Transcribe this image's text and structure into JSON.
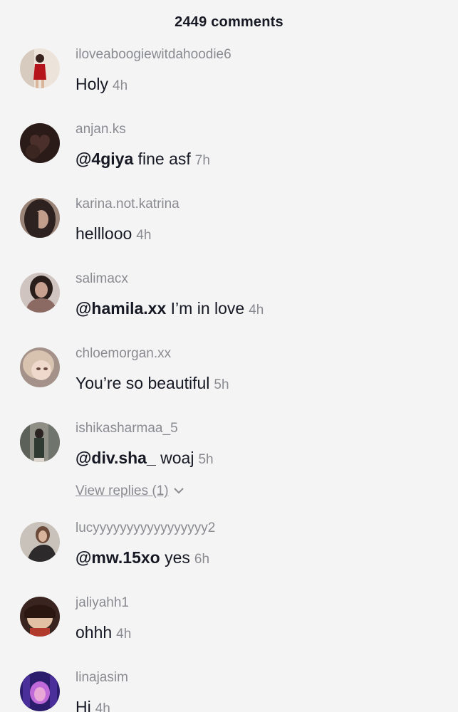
{
  "header": {
    "title": "2449 comments"
  },
  "comments": [
    {
      "username": "iloveaboogiewitdahoodie6",
      "mention": "",
      "text": "Holy",
      "time": "4h",
      "avatar_colors": [
        "#e9dcd2",
        "#b5141b"
      ]
    },
    {
      "username": "anjan.ks",
      "mention": "@4giya",
      "text": "fine asf",
      "time": "7h",
      "avatar_colors": [
        "#2a1a18",
        "#5a3a33"
      ]
    },
    {
      "username": "karina.not.katrina",
      "mention": "",
      "text": "helllooo",
      "time": "4h",
      "avatar_colors": [
        "#3b2e2b",
        "#a48a7f"
      ]
    },
    {
      "username": "salimacx",
      "mention": "@hamila.xx",
      "text": "I’m in love",
      "time": "4h",
      "avatar_colors": [
        "#8b6a63",
        "#cfa89a"
      ]
    },
    {
      "username": "chloemorgan.xx",
      "mention": "",
      "text": "You’re so beautiful",
      "time": "5h",
      "avatar_colors": [
        "#d9c3b7",
        "#f0e2d8"
      ]
    },
    {
      "username": "ishikasharmaa_5",
      "mention": "@div.sha_",
      "text": "woaj",
      "time": "5h",
      "avatar_colors": [
        "#6e6f66",
        "#2f3a33"
      ]
    },
    {
      "username": "lucyyyyyyyyyyyyyyyyy2",
      "mention": "@mw.15xo",
      "text": "yes",
      "time": "6h",
      "avatar_colors": [
        "#b9b1a9",
        "#2d2a2b"
      ]
    },
    {
      "username": "jaliyahh1",
      "mention": "",
      "text": "ohhh",
      "time": "4h",
      "avatar_colors": [
        "#5a3628",
        "#e6c4a9"
      ]
    },
    {
      "username": "linajasim",
      "mention": "",
      "text": "Hi",
      "time": "4h",
      "avatar_colors": [
        "#2b1d6b",
        "#c06ad9"
      ]
    }
  ],
  "view_replies": {
    "label": "View replies (1)"
  }
}
